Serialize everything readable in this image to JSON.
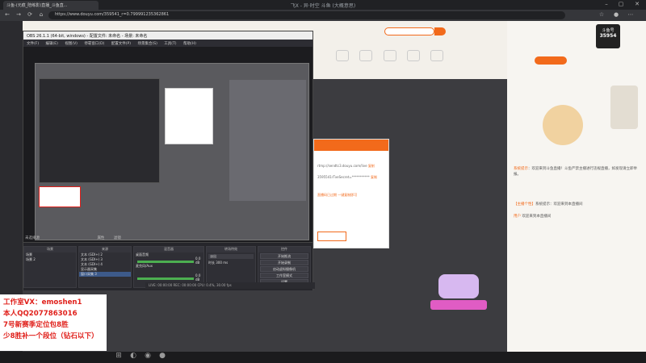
{
  "browser": {
    "tab_title": "斗鱼-(元痕_陪练影)直播_斗鱼直...",
    "window_title": "飞X - 异·时空 斗鱼 (大概意思)",
    "url": "https://www.douyu.com/359541_r=0.799991235362861"
  },
  "obs": {
    "title": "OBS 26.1.1 (64-bit, windows) - 配置文件: 未命名 - 场景: 未命名",
    "menu": [
      "文件(F)",
      "编辑(E)",
      "视图(V)",
      "停靠窗口(D)",
      "配置文件(P)",
      "场景集合(S)",
      "工具(T)",
      "帮助(H)"
    ],
    "no_source_label": "未选择源",
    "props_label": "属性",
    "filters_label": "滤镜",
    "docks": {
      "scenes": {
        "title": "场景",
        "items": [
          "场景",
          "场景 2"
        ]
      },
      "sources": {
        "title": "来源",
        "items": [
          "文本 (GDI+) 2",
          "文本 (GDI+) 3",
          "文本 (GDI+) 4",
          "显示器采集",
          "窗口采集 3"
        ]
      },
      "mixer": {
        "title": "混音器",
        "tracks": [
          {
            "name": "桌面音频",
            "level": "0.0 dB"
          },
          {
            "name": "麦克风/Aux",
            "level": "0.0 dB"
          }
        ]
      },
      "transitions": {
        "title": "转场特效",
        "type": "淡出",
        "duration_label": "时长",
        "duration": "300 ms"
      },
      "controls": {
        "title": "控件",
        "buttons": [
          "开始推流",
          "开始录制",
          "启动虚拟摄像机",
          "工作室模式",
          "设置",
          "退出"
        ]
      }
    },
    "status": "LIVE: 00:00:00    REC: 00:00:00    CPU: 0.4%, 30.00 fps"
  },
  "modal": {
    "rows": [
      "rtmp://sendtc3.douyu.com/live",
      "3595541rTxeSecret=***********"
    ],
    "copy_label": "复制",
    "hint": "直播码已过期 一键复制即可"
  },
  "promo": {
    "lines": [
      "工作室VX：emoshen1",
      "本人QQ2077863016",
      "7号新赛季定位包8胜",
      "少8胜补一个段位（钻石以下）"
    ]
  },
  "chat": {
    "messages": [
      {
        "name": "系统提示",
        "text": "：欢迎来到斗鱼直播！斗鱼严禁主播进行违规直播，如发现请立即举报。"
      },
      {
        "name": "【主播个性】",
        "text": "系统提示：欢迎来到本直播间"
      },
      {
        "name": "用户",
        "text": "欢迎来到本直播间"
      }
    ]
  },
  "side": {
    "hot_label": "斗鱼号",
    "hot_number": "35954"
  },
  "colors": {
    "accent": "#f26a1b",
    "promo_red": "#e0201b"
  }
}
